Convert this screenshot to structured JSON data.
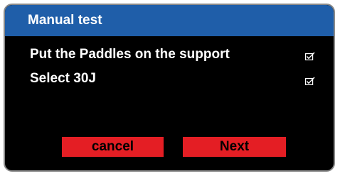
{
  "dialog": {
    "title": "Manual test",
    "steps": [
      {
        "label": "Put the Paddles on the support",
        "checked": true
      },
      {
        "label": "Select 30J",
        "checked": true
      }
    ],
    "buttons": {
      "cancel_label": "cancel",
      "next_label": "Next"
    }
  },
  "colors": {
    "titlebar": "#1f5ea9",
    "background": "#000000",
    "button": "#e41e24",
    "text": "#ffffff",
    "button_text": "#000000",
    "border": "#8a8a8a"
  },
  "icons": {
    "step_status": "checkbox-checked-icon"
  }
}
